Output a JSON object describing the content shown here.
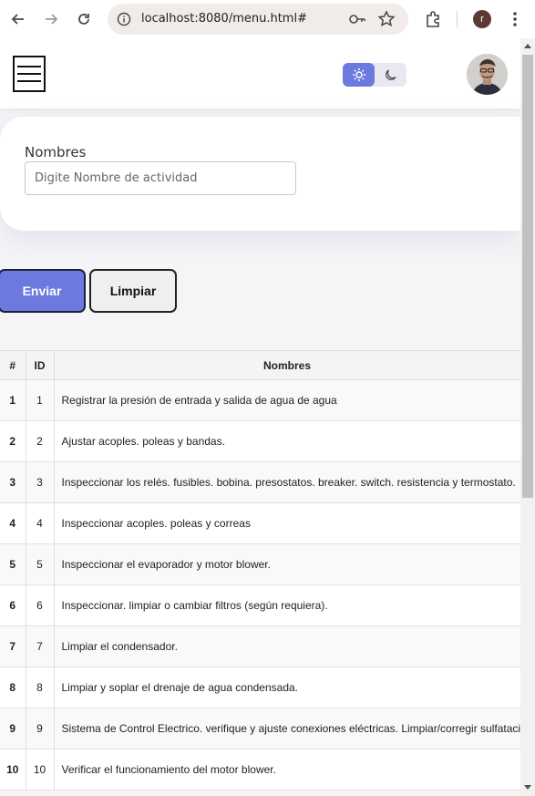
{
  "browser": {
    "url": "localhost:8080/menu.html#",
    "profile_initial": "r"
  },
  "header": {
    "theme_active": "light"
  },
  "form": {
    "label": "Nombres",
    "input_value": "",
    "placeholder": "Digite Nombre de actividad"
  },
  "buttons": {
    "send": "Enviar",
    "clear": "Limpiar"
  },
  "table": {
    "headers": [
      "#",
      "ID",
      "Nombres"
    ],
    "rows": [
      {
        "num": "1",
        "id": "1",
        "name": "Registrar la presión de entrada y salida de agua de agua"
      },
      {
        "num": "2",
        "id": "2",
        "name": "Ajustar acoples. poleas y bandas."
      },
      {
        "num": "3",
        "id": "3",
        "name": "Inspeccionar los relés. fusibles. bobina. presostatos. breaker. switch. resistencia y termostato."
      },
      {
        "num": "4",
        "id": "4",
        "name": "Inspeccionar acoples. poleas y correas"
      },
      {
        "num": "5",
        "id": "5",
        "name": "Inspeccionar el evaporador y motor blower."
      },
      {
        "num": "6",
        "id": "6",
        "name": "Inspeccionar. limpiar o cambiar filtros (según requiera)."
      },
      {
        "num": "7",
        "id": "7",
        "name": "Limpiar el condensador."
      },
      {
        "num": "8",
        "id": "8",
        "name": "Limpiar y soplar el drenaje de agua condensada."
      },
      {
        "num": "9",
        "id": "9",
        "name": "Sistema de Control Electrico. verifique y ajuste conexiones eléctricas. Limpiar/corregir sulfataci"
      },
      {
        "num": "10",
        "id": "10",
        "name": "Verificar el funcionamiento del motor blower."
      }
    ]
  },
  "colors": {
    "accent": "#6c7ae0",
    "page_bg": "#f5f5f7"
  }
}
